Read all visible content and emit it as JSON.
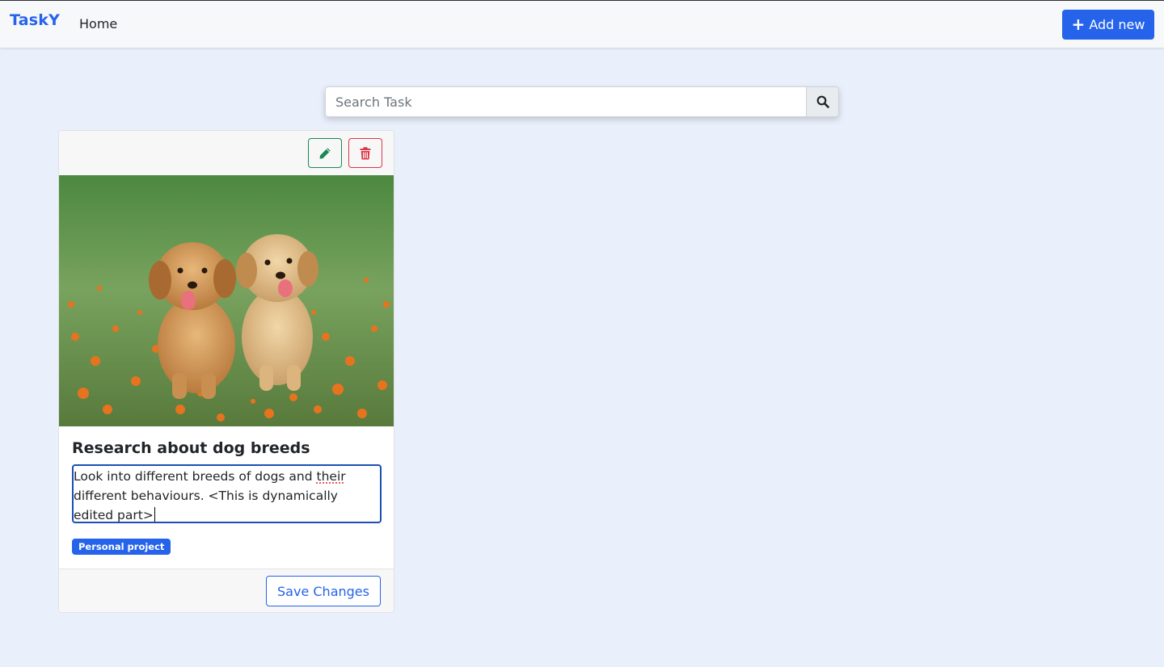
{
  "navbar": {
    "brand": "TaskY",
    "home_label": "Home",
    "add_button": {
      "icon": "plus-icon",
      "label": "Add new"
    }
  },
  "search": {
    "placeholder": "Search Task",
    "value": "",
    "button_icon": "search-icon"
  },
  "card": {
    "edit_icon": "pencil-icon",
    "delete_icon": "trash-icon",
    "image_alt": "puppies",
    "title": "Research about dog breeds",
    "description_part1": "Look into different breeds of dogs and ",
    "description_misspelled": "their",
    "description_part2": " different behaviours. <This is dynamically edited part>",
    "badge": "Personal project",
    "save_label": "Save Changes"
  },
  "colors": {
    "primary": "#2563eb",
    "success": "#198754",
    "danger": "#dc3545",
    "page_background": "#e9effb"
  }
}
